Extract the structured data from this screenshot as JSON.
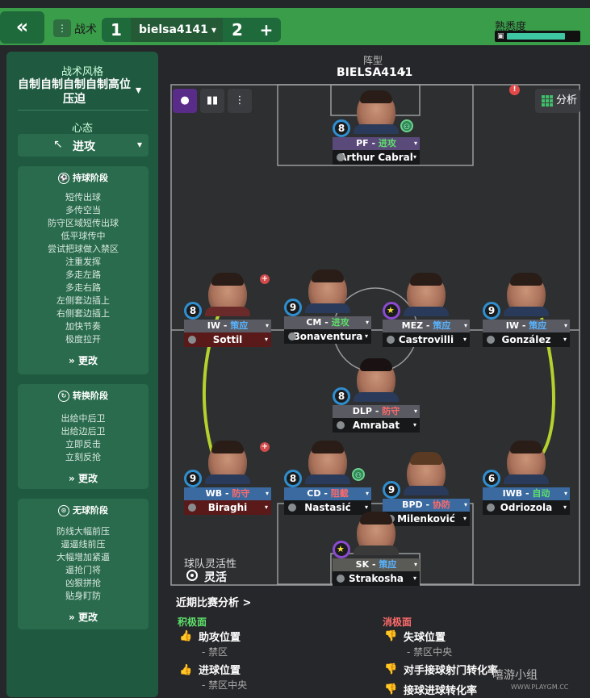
{
  "topbar": {
    "back_icon": "«",
    "tactic_label": "战术",
    "tab1": "1",
    "active_tab": "bielsa4141",
    "tab2": "2",
    "add": "+",
    "familiarity_label": "熟悉度",
    "familiarity_level": 0.82
  },
  "sidebar": {
    "style_title": "战术风格",
    "style_name": "自制自制自制自制高位压迫",
    "mentality_title": "心态",
    "mentality_value": "进攻",
    "in_possession": {
      "title": "持球阶段",
      "items": [
        "短传出球",
        "多传空当",
        "防守区域短传出球",
        "低平球传中",
        "尝试把球做入禁区",
        "注重发挥",
        "多走左路",
        "多走右路",
        "左侧套边插上",
        "右侧套边插上",
        "加快节奏",
        "极度拉开"
      ],
      "more": "更改"
    },
    "transition": {
      "title": "转换阶段",
      "items": [
        "出给中后卫",
        "出给边后卫",
        "立即反击",
        "立刻反抢"
      ],
      "more": "更改"
    },
    "out_possession": {
      "title": "无球阶段",
      "items": [
        "防线大幅前压",
        "逼逼线前压",
        "大幅增加紧逼",
        "逼抢门将",
        "凶狠拼抢",
        "贴身盯防"
      ],
      "more": "更改"
    }
  },
  "main": {
    "formation_title": "阵型",
    "formation_name": "BIELSA4141",
    "analysis_label": "分析",
    "alert": "!",
    "players": [
      {
        "rating": "8",
        "role": "PF",
        "duty": "进攻",
        "duty_type": "attack",
        "name": "Arthur Cabral"
      },
      {
        "rating": "8",
        "role": "IW",
        "duty": "策应",
        "duty_type": "support",
        "name": "Sottil"
      },
      {
        "rating": "9",
        "role": "CM",
        "duty": "进攻",
        "duty_type": "attack",
        "name": "Bonaventura"
      },
      {
        "rating": "",
        "role": "MEZ",
        "duty": "策应",
        "duty_type": "support",
        "name": "Castrovilli"
      },
      {
        "rating": "9",
        "role": "IW",
        "duty": "策应",
        "duty_type": "support",
        "name": "González"
      },
      {
        "rating": "8",
        "role": "DLP",
        "duty": "防守",
        "duty_type": "defend",
        "name": "Amrabat"
      },
      {
        "rating": "9",
        "role": "WB",
        "duty": "防守",
        "duty_type": "defend",
        "name": "Biraghi"
      },
      {
        "rating": "8",
        "role": "CD",
        "duty": "阻截",
        "duty_type": "defend",
        "name": "Nastasić"
      },
      {
        "rating": "9",
        "role": "BPD",
        "duty": "协防",
        "duty_type": "defend",
        "name": "Milenković"
      },
      {
        "rating": "6",
        "role": "IWB",
        "duty": "自动",
        "duty_type": "auto",
        "name": "Odriozola"
      },
      {
        "rating": "",
        "role": "SK",
        "duty": "策应",
        "duty_type": "support",
        "name": "Strakosha"
      }
    ],
    "flex_label": "球队灵活性",
    "flex_value": "灵活"
  },
  "analysis": {
    "recent_link": "近期比赛分析 >",
    "positives_title": "积极面",
    "negatives_title": "消极面",
    "positives": [
      {
        "title": "助攻位置",
        "sub": "- 禁区"
      },
      {
        "title": "进球位置",
        "sub": "- 禁区中央"
      }
    ],
    "negatives": [
      {
        "title": "失球位置",
        "sub": "- 禁区中央"
      },
      {
        "title": "对手接球射门转化率",
        "sub": ""
      },
      {
        "title": "接球进球转化率",
        "sub": ""
      }
    ]
  },
  "watermark": {
    "text": "嘻游小组",
    "url": "WWW.PLAYGM.CC"
  },
  "colors": {
    "accent_green": "#3a9d4a",
    "sidebar": "#1f5a40",
    "support": "#58b4ff",
    "attack": "#5ee06b",
    "defend": "#ff6b6b"
  }
}
